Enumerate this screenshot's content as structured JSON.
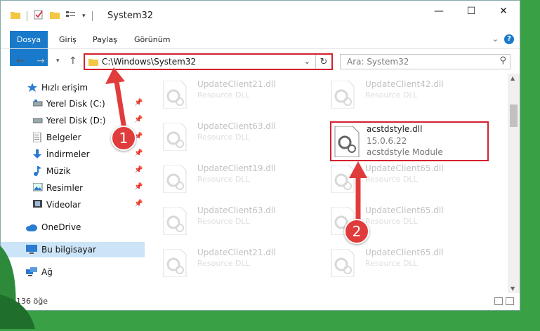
{
  "window": {
    "title": "System32",
    "controls": [
      "—",
      "☐",
      "✕"
    ]
  },
  "ribbon": {
    "tabs": [
      "Dosya",
      "Giriş",
      "Paylaş",
      "Görünüm"
    ]
  },
  "address": {
    "path": "C:\\Windows\\System32"
  },
  "search": {
    "placeholder": "Ara: System32"
  },
  "sidebar": {
    "quick_access": "Hızlı erişim",
    "items": [
      {
        "label": "Yerel Disk (C:)",
        "icon": "drive-icon",
        "pinned": true
      },
      {
        "label": "Yerel Disk (D:)",
        "icon": "drive-icon",
        "pinned": true
      },
      {
        "label": "Belgeler",
        "icon": "documents-icon",
        "pinned": true
      },
      {
        "label": "İndirmeler",
        "icon": "download-icon",
        "pinned": true
      },
      {
        "label": "Müzik",
        "icon": "music-icon",
        "pinned": true
      },
      {
        "label": "Resimler",
        "icon": "pictures-icon",
        "pinned": true
      },
      {
        "label": "Videolar",
        "icon": "videos-icon",
        "pinned": true
      }
    ],
    "onedrive": "OneDrive",
    "this_pc": "Bu bilgisayar",
    "network": "Ağ"
  },
  "files": {
    "left": [
      {
        "name": "UpdateClient21.dll",
        "desc": "Resource DLL"
      },
      {
        "name": "UpdateClient63.dll",
        "desc": "Resource DLL"
      },
      {
        "name": "UpdateClient19.dll",
        "desc": "Resource DLL"
      },
      {
        "name": "UpdateClient63.dll",
        "desc": "Resource DLL"
      },
      {
        "name": "UpdateClient21.dll",
        "desc": "Resource DLL"
      }
    ],
    "right": [
      {
        "name": "UpdateClient42.dll",
        "desc": "Resource DLL"
      },
      {
        "name": "UpdateClient65.dll",
        "desc": "Resource DLL"
      },
      {
        "name": "UpdateClient65.dll",
        "desc": "Resource DLL"
      },
      {
        "name": "UpdateClient65.dll",
        "desc": "Resource DLL"
      }
    ],
    "highlighted": {
      "name": "acstdstyle.dll",
      "version": "15.0.6.22",
      "desc": "acstdstyle Module"
    }
  },
  "status": {
    "count": "136 öğe"
  },
  "annotations": {
    "badge1": "1",
    "badge2": "2",
    "color": "#d3202e"
  }
}
